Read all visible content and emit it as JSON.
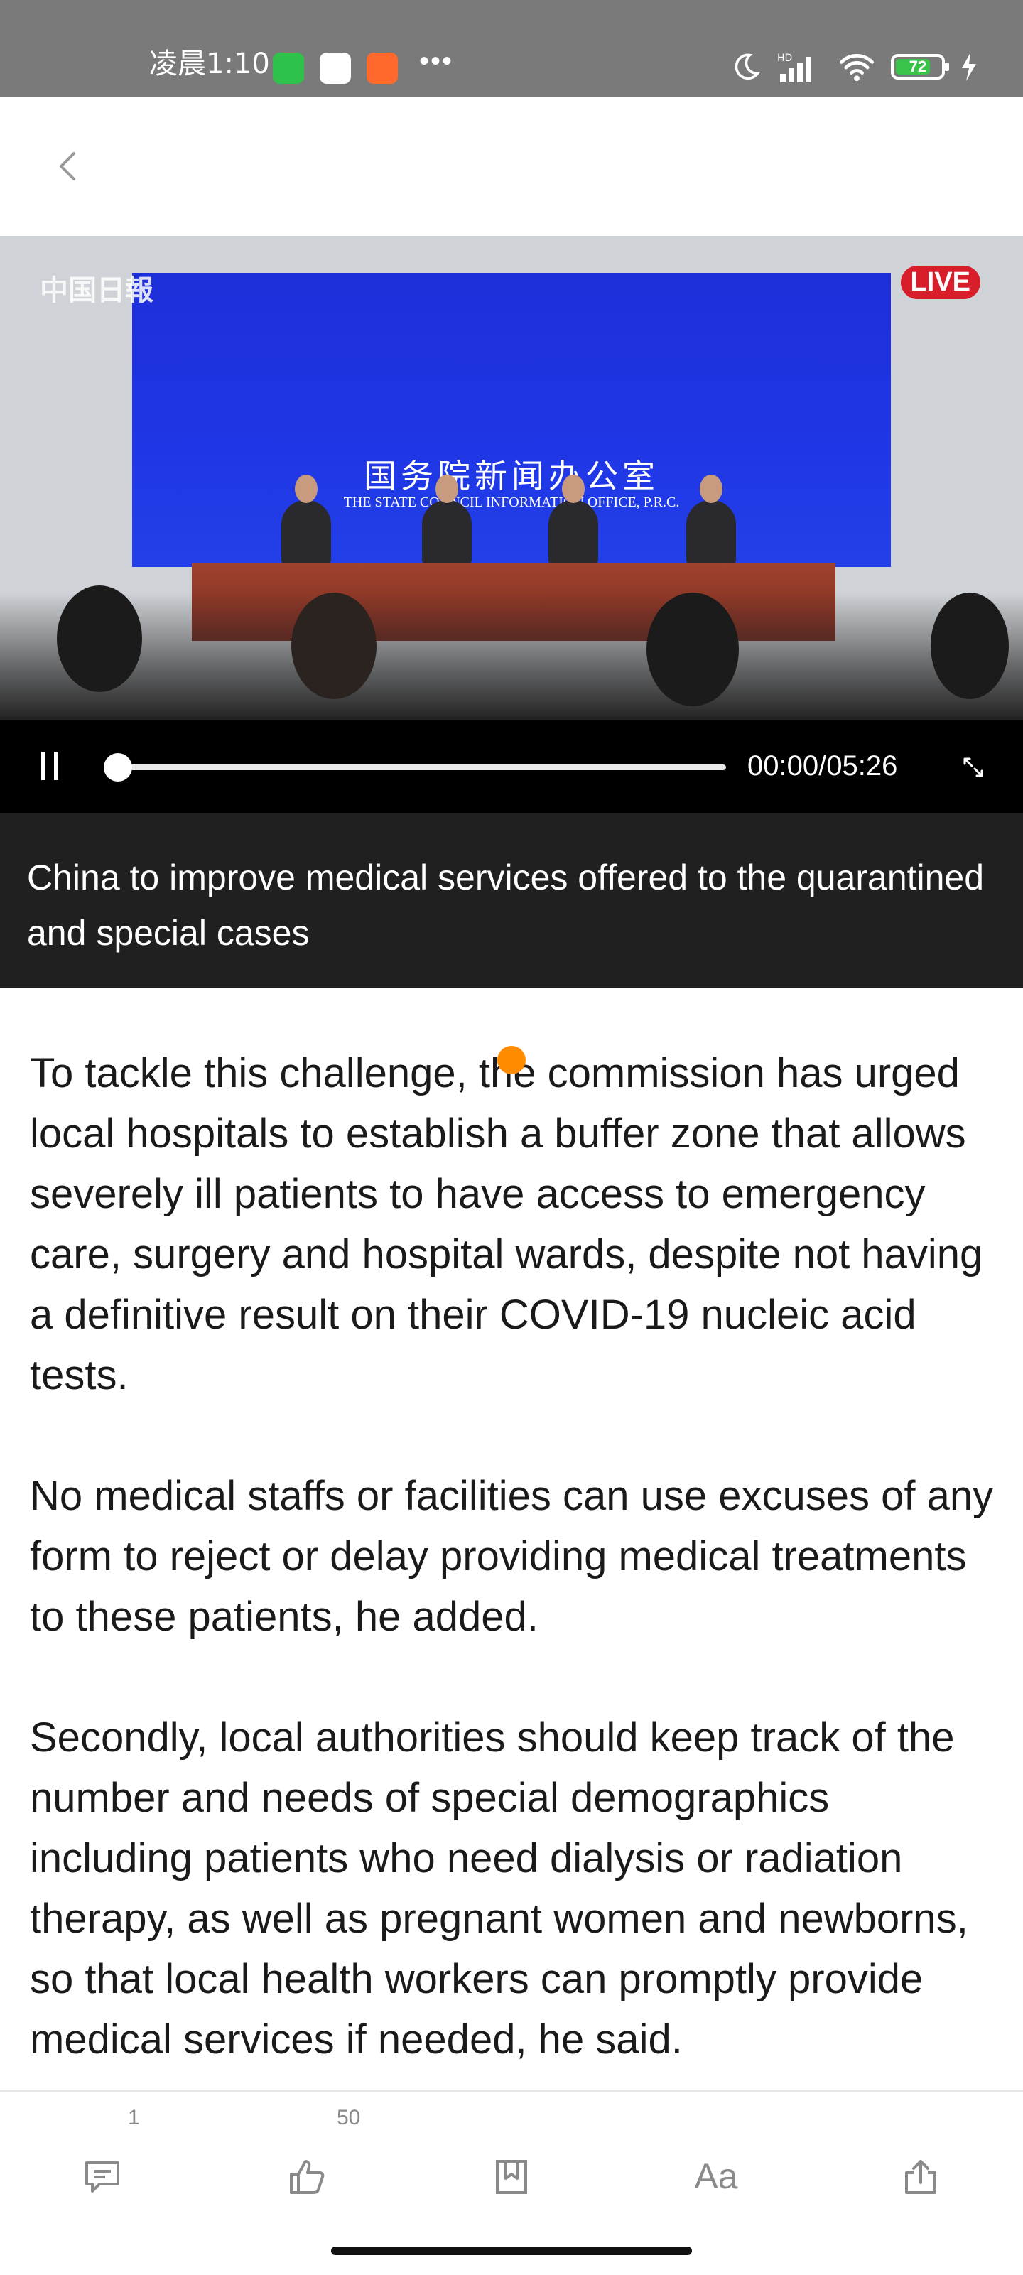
{
  "status_bar": {
    "time": "凌晨1:10",
    "battery": "72",
    "network": "HD"
  },
  "video": {
    "live_label": "LIVE",
    "watermark": "中国日報",
    "stage_title_cn": "国务院新闻办公室",
    "stage_title_en": "THE STATE COUNCIL INFORMATION OFFICE, P.R.C.",
    "time_display": "00:00/05:26",
    "progress": 0
  },
  "caption": "China to improve medical services offered to the quarantined and special cases",
  "article": {
    "paragraphs": [
      "To tackle this challenge, the commission has urged local hospitals to establish a buffer zone that allows severely ill patients to have access to emergency care, surgery and hospital wards, despite not having a definitive result on their COVID-19 nucleic acid tests.",
      "No medical staffs or facilities can use excuses of any form to reject or delay providing medical treatments to these patients, he added.",
      "Secondly, local authorities should keep track of the number and needs of special demographics including patients who need dialysis or radiation therapy, as well as pregnant women and newborns, so that local health workers can promptly provide medical services if needed, he said."
    ]
  },
  "bottom_bar": {
    "comment_count": "1",
    "like_count": "50",
    "font_label": "Aa"
  },
  "colors": {
    "accent_dot": "#ff8b00",
    "live_red": "#d81e2b",
    "stage_blue": "#1f36e6"
  }
}
